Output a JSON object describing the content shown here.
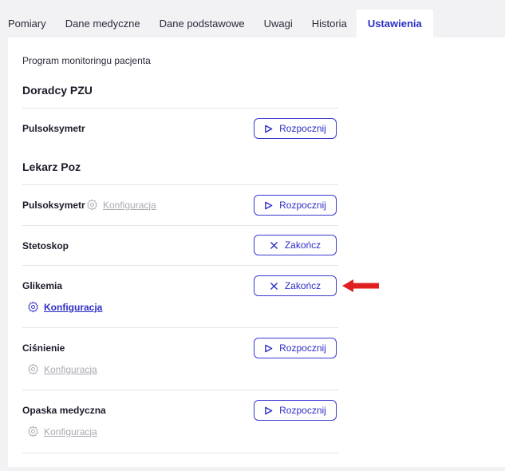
{
  "tabs": [
    {
      "label": "Pomiary"
    },
    {
      "label": "Dane medyczne"
    },
    {
      "label": "Dane podstawowe"
    },
    {
      "label": "Uwagi"
    },
    {
      "label": "Historia"
    },
    {
      "label": "Ustawienia"
    }
  ],
  "active_tab": "Ustawienia",
  "intro": "Program monitoringu pacjenta",
  "groups": [
    {
      "title": "Doradcy PZU"
    },
    {
      "title": "Lekarz Poz"
    }
  ],
  "rows": [
    {
      "label": "Pulsoksymetr",
      "button": "Rozpocznij",
      "button_icon": "play-icon"
    },
    {
      "label": "Pulsoksymetr",
      "config": "Konfiguracja",
      "config_state": "disabled",
      "button": "Rozpocznij",
      "button_icon": "play-icon"
    },
    {
      "label": "Stetoskop",
      "button": "Zakończ",
      "button_icon": "close-icon"
    },
    {
      "label": "Glikemia",
      "config": "Konfiguracja",
      "config_state": "enabled",
      "button": "Zakończ",
      "button_icon": "close-icon"
    },
    {
      "label": "Ciśnienie",
      "config": "Konfiguracja",
      "config_state": "disabled",
      "button": "Rozpocznij",
      "button_icon": "play-icon"
    },
    {
      "label": "Opaska medyczna",
      "config": "Konfiguracja",
      "config_state": "disabled",
      "button": "Rozpocznij",
      "button_icon": "play-icon"
    }
  ],
  "colors": {
    "accent": "#2d2dc6",
    "disabled": "#a9a9b2",
    "arrow": "#e02020"
  },
  "annotation_icon": "red-arrow-icon"
}
